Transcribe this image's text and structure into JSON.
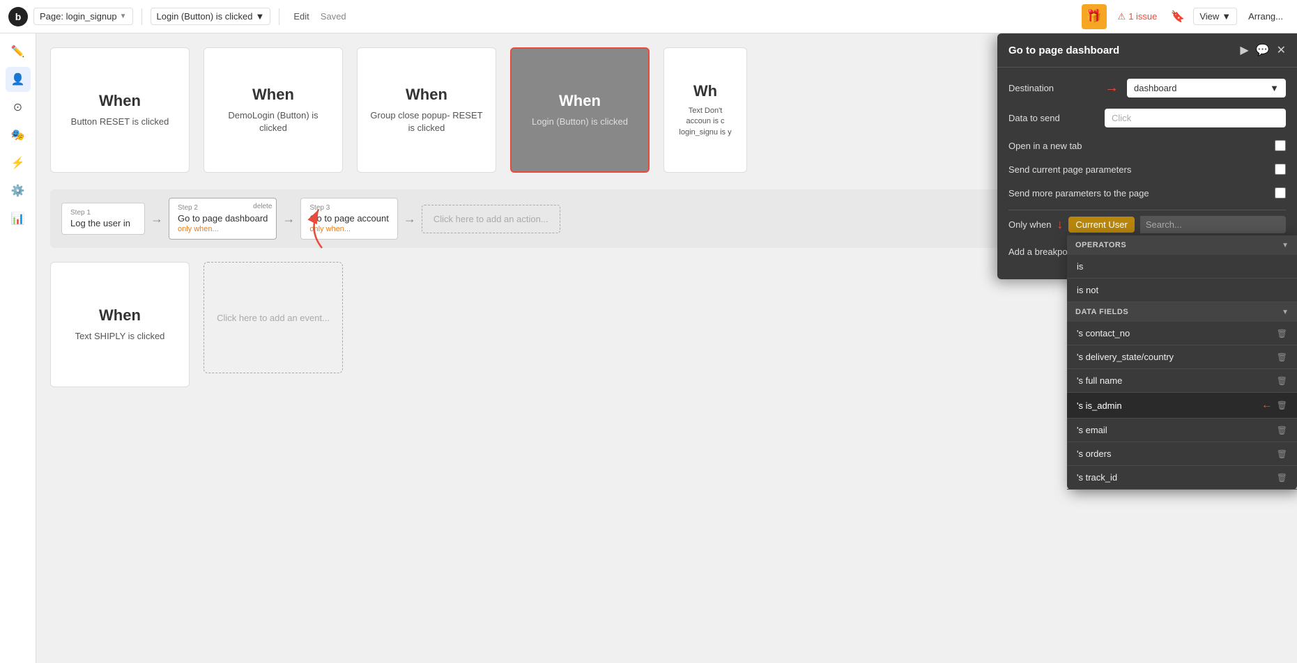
{
  "topbar": {
    "logo": "b",
    "page_label": "Page: login_signup",
    "page_chevron": "▼",
    "workflow_label": "Login (Button) is clicked",
    "workflow_chevron": "▼",
    "edit_label": "Edit",
    "saved_label": "Saved",
    "gift_icon": "🎁",
    "issue_label": "1 issue",
    "bookmark_icon": "🔖",
    "view_label": "View",
    "view_chevron": "▼",
    "arrange_label": "Arrang..."
  },
  "sidebar": {
    "icons": [
      "✏️",
      "👤",
      "⊙",
      "🎭",
      "⚡",
      "⚙️",
      "📊"
    ]
  },
  "trigger_cards": [
    {
      "when": "When",
      "desc": "Button RESET is clicked"
    },
    {
      "when": "When",
      "desc": "DemoLogin (Button) is clicked"
    },
    {
      "when": "When",
      "desc": "Group close popup- RESET is clicked"
    },
    {
      "when": "When",
      "desc": "Login (Button) is clicked",
      "selected": true
    },
    {
      "when": "Wh",
      "desc": "Text Don't accoun is c login_signu is y",
      "partial": true
    }
  ],
  "steps": [
    {
      "label": "Step 1",
      "title": "Log the user in",
      "subtitle": ""
    },
    {
      "label": "Step 2",
      "title": "Go to page dashboard",
      "subtitle": "only when...",
      "has_delete": true
    },
    {
      "label": "Step 3",
      "title": "Go to page account",
      "subtitle": "only when..."
    },
    {
      "label": "",
      "title": "Click here to add an action...",
      "dashed": true
    }
  ],
  "workflow_row2": {
    "trigger_when": "When",
    "trigger_desc": "Text SHIPLY is clicked",
    "add_event_label": "Click here to add an event..."
  },
  "panel": {
    "title": "Go to page dashboard",
    "play_icon": "▶",
    "chat_icon": "💬",
    "close_icon": "✕",
    "destination_label": "Destination",
    "destination_value": "dashboard",
    "destination_chevron": "▼",
    "data_to_send_label": "Data to send",
    "data_to_send_placeholder": "Click",
    "open_new_tab_label": "Open in a new tab",
    "send_current_params_label": "Send current page parameters",
    "send_more_params_label": "Send more parameters to the page",
    "only_when_label": "Only when",
    "current_user_tag": "Current User",
    "search_placeholder": "Search...",
    "add_breakpoint_label": "Add a breakpoint in debug",
    "red_arrow_label": "→"
  },
  "dropdown": {
    "sections": [
      {
        "label": "OPERATORS",
        "chevron": "▼",
        "items": [
          {
            "text": "is",
            "has_icon": false
          },
          {
            "text": "is not",
            "has_icon": false
          }
        ]
      },
      {
        "label": "DATA FIELDS",
        "chevron": "▼",
        "items": [
          {
            "text": "'s contact_no",
            "has_icon": true
          },
          {
            "text": "'s delivery_state/country",
            "has_icon": true
          },
          {
            "text": "'s full name",
            "has_icon": true
          },
          {
            "text": "'s is_admin",
            "has_icon": true,
            "highlighted": true
          },
          {
            "text": "'s email",
            "has_icon": true
          },
          {
            "text": "'s orders",
            "has_icon": true
          },
          {
            "text": "'s track_id",
            "has_icon": true
          }
        ]
      }
    ]
  }
}
